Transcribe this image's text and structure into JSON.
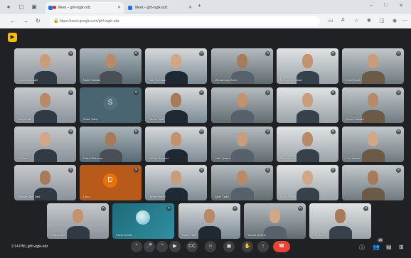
{
  "browser": {
    "tabs": [
      {
        "title": "Meet – ghf-vqpk-odz",
        "active": true
      },
      {
        "title": "Meet – ghf-vqpk-odz",
        "active": false
      }
    ],
    "new_tab": "+",
    "url": "https://meet.google.com/ghf-vqpk-odz",
    "window_controls": [
      "–",
      "□",
      "✕"
    ]
  },
  "meet": {
    "meeting_code": "ghf-vqpk-odz",
    "time": "2:14 PM",
    "separator": "|",
    "participants": [
      {
        "name": "Ahmad Al-Masri",
        "type": "video"
      },
      {
        "name": "Nabil Haddad",
        "type": "video"
      },
      {
        "name": "Said Hamdan",
        "type": "video"
      },
      {
        "name": "Mohammad Jaber",
        "type": "video"
      },
      {
        "name": "Mahmoud Nasser",
        "type": "video"
      },
      {
        "name": "Khalil Saleh",
        "type": "video"
      },
      {
        "name": "Issa Khalil",
        "type": "video"
      },
      {
        "name": "Shadi Sabri",
        "type": "avatar",
        "initial": "S"
      },
      {
        "name": "Ramzi Yusuf",
        "type": "video"
      },
      {
        "name": "",
        "type": "video"
      },
      {
        "name": "",
        "type": "video"
      },
      {
        "name": "Amira Haddad",
        "type": "video"
      },
      {
        "name": "Ali Fares",
        "type": "video"
      },
      {
        "name": "Faisal Mansour",
        "type": "video"
      },
      {
        "name": "Hisham Hamad",
        "type": "video"
      },
      {
        "name": "Laith Qasem",
        "type": "video"
      },
      {
        "name": "Sami Awad",
        "type": "video"
      },
      {
        "name": "Fadi Nasser",
        "type": "video"
      },
      {
        "name": "Bassam Abu Zaid",
        "type": "video"
      },
      {
        "name": "Dana",
        "type": "avatar",
        "initial": "D"
      },
      {
        "name": "Omar Khaled",
        "type": "video"
      },
      {
        "name": "Wael Saad",
        "type": "video"
      },
      {
        "name": "Majdi Salem",
        "type": "video"
      },
      {
        "name": "",
        "type": "video"
      },
      {
        "name": "Walid Nimer",
        "type": "video"
      },
      {
        "name": "Rania Kuttab",
        "type": "image"
      },
      {
        "name": "Naser Odeh",
        "type": "video"
      },
      {
        "name": "Yousef Qasem",
        "type": "video"
      },
      {
        "name": "Zaid Musa",
        "type": "video"
      }
    ]
  },
  "controls": {
    "mic_icon": "microphone-icon",
    "cam_icon": "camera-icon",
    "captions_icon": "captions-icon",
    "emoji_icon": "emoji-icon",
    "present_icon": "present-icon",
    "hand_icon": "raise-hand-icon",
    "more_icon": "more-vert-icon",
    "end_icon": "end-call-icon",
    "people_count": "29"
  },
  "colors": {
    "meet_bg": "#202124",
    "tile_bg": "#3c4043",
    "end_call": "#ea4335",
    "avatar_s": "#546e7a",
    "avatar_d": "#e8710a",
    "accent": "#1a73e8"
  }
}
